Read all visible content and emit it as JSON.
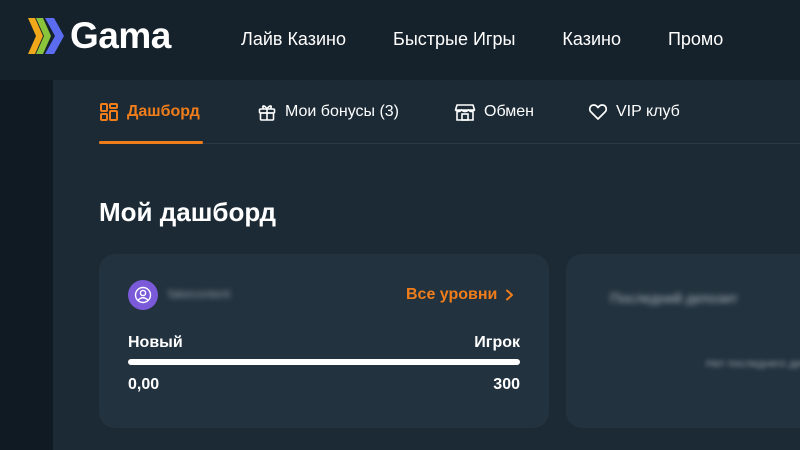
{
  "header": {
    "logo_text": "Gama",
    "nav": [
      "Лайв Казино",
      "Быстрые Игры",
      "Казино",
      "Промо"
    ]
  },
  "tabs": [
    {
      "label": "Дашборд",
      "icon": "dashboard-icon",
      "active": true
    },
    {
      "label": "Мои бонусы (3)",
      "icon": "gift-icon",
      "active": false
    },
    {
      "label": "Обмен",
      "icon": "shop-icon",
      "active": false
    },
    {
      "label": "VIP клуб",
      "icon": "heart-icon",
      "active": false
    }
  ],
  "page_title": "Мой дашборд",
  "level_card": {
    "username": "fakecontent",
    "all_levels_label": "Все уровни",
    "current_level": "Новый",
    "next_level": "Игрок",
    "current_points": "0,00",
    "target_points": "300",
    "progress_fraction": 0
  },
  "deposit_card": {
    "title": "Последний депозит",
    "empty_text": "Нет последнего депозита"
  },
  "colors": {
    "accent": "#f07d1a",
    "background": "#132029",
    "panel": "#1b2a35",
    "card": "#22323e",
    "avatar": "#7a5ad8"
  }
}
